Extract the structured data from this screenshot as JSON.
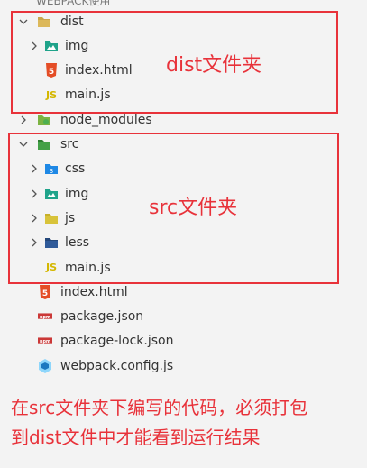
{
  "header": {
    "title": "WEBPACK使用"
  },
  "tree": [
    {
      "name": "dist",
      "kind": "folder",
      "expanded": true,
      "depth": 0
    },
    {
      "name": "img",
      "kind": "img-folder",
      "expanded": false,
      "depth": 1
    },
    {
      "name": "index.html",
      "kind": "html",
      "depth": 1
    },
    {
      "name": "main.js",
      "kind": "js",
      "depth": 1
    },
    {
      "name": "node_modules",
      "kind": "node-folder",
      "expanded": false,
      "depth": 0
    },
    {
      "name": "src",
      "kind": "src-folder",
      "expanded": true,
      "depth": 0
    },
    {
      "name": "css",
      "kind": "css-folder",
      "expanded": false,
      "depth": 1
    },
    {
      "name": "img",
      "kind": "img-folder",
      "expanded": false,
      "depth": 1
    },
    {
      "name": "js",
      "kind": "js-folder",
      "expanded": false,
      "depth": 1
    },
    {
      "name": "less",
      "kind": "less-folder",
      "expanded": false,
      "depth": 1
    },
    {
      "name": "main.js",
      "kind": "js",
      "depth": 1
    },
    {
      "name": "index.html",
      "kind": "html",
      "depth": 0
    },
    {
      "name": "package.json",
      "kind": "npm",
      "depth": 0
    },
    {
      "name": "package-lock.json",
      "kind": "npm",
      "depth": 0
    },
    {
      "name": "webpack.config.js",
      "kind": "webpack",
      "depth": 0
    }
  ],
  "annotations": {
    "dist_label": "dist文件夹",
    "src_label": "src文件夹",
    "note_line1": "在src文件夹下编写的代码，必须打包",
    "note_line2": "到dist文件中才能看到运行结果"
  },
  "colors": {
    "accent_red": "#e8323a"
  }
}
